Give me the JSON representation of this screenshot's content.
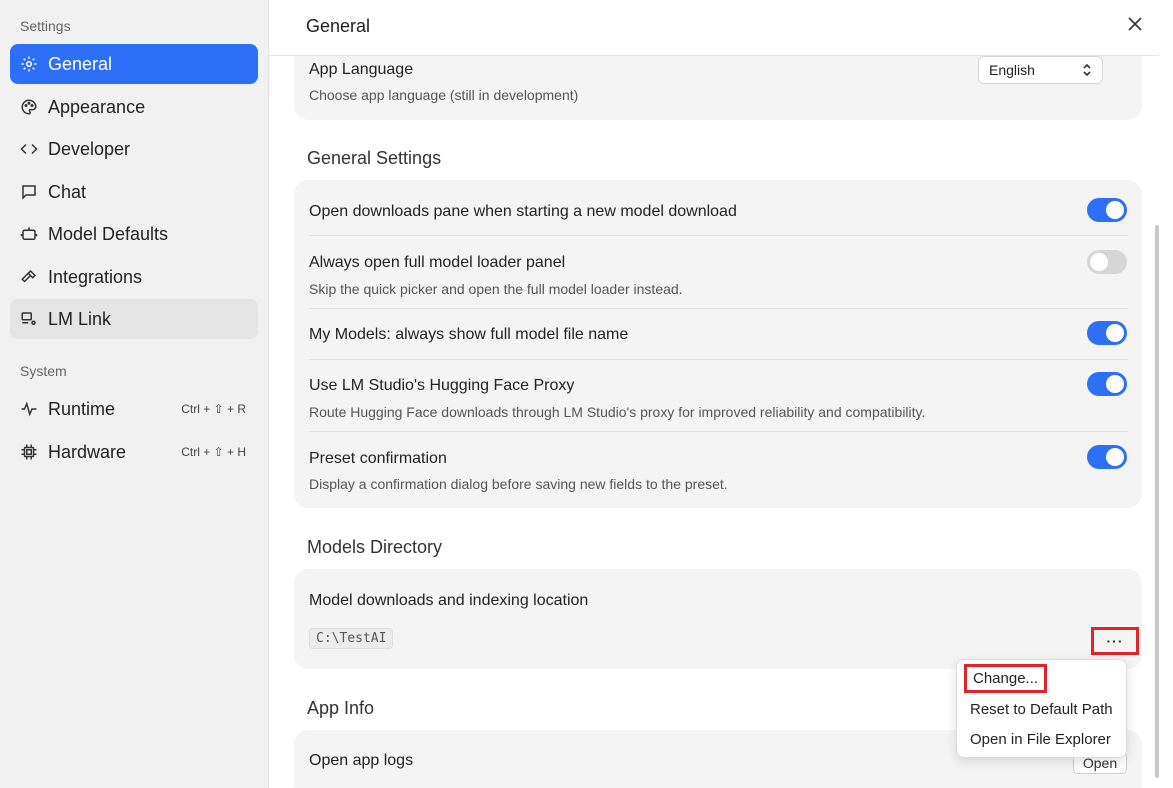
{
  "sidebar": {
    "settings_heading": "Settings",
    "system_heading": "System",
    "items": [
      {
        "label": "General"
      },
      {
        "label": "Appearance"
      },
      {
        "label": "Developer"
      },
      {
        "label": "Chat"
      },
      {
        "label": "Model Defaults"
      },
      {
        "label": "Integrations"
      },
      {
        "label": "LM Link"
      }
    ],
    "system_items": [
      {
        "label": "Runtime",
        "shortcut": "Ctrl + ⇧ + R"
      },
      {
        "label": "Hardware",
        "shortcut": "Ctrl + ⇧ + H"
      }
    ]
  },
  "header": {
    "title": "General"
  },
  "language": {
    "label": "App Language",
    "description": "Choose app language (still in development)",
    "selected": "English"
  },
  "general_settings": {
    "title": "General Settings",
    "rows": [
      {
        "label": "Open downloads pane when starting a new model download",
        "enabled": true
      },
      {
        "label": "Always open full model loader panel",
        "description": "Skip the quick picker and open the full model loader instead.",
        "enabled": false
      },
      {
        "label": "My Models: always show full model file name",
        "enabled": true
      },
      {
        "label": "Use LM Studio's Hugging Face Proxy",
        "description": "Route Hugging Face downloads through LM Studio's proxy for improved reliability and compatibility.",
        "enabled": true
      },
      {
        "label": "Preset confirmation",
        "description": "Display a confirmation dialog before saving new fields to the preset.",
        "enabled": true
      }
    ]
  },
  "models_directory": {
    "title": "Models Directory",
    "label": "Model downloads and indexing location",
    "path": "C:\\TestAI",
    "more_label": "···"
  },
  "context_menu": {
    "items": [
      "Change...",
      "Reset to Default Path",
      "Open in File Explorer"
    ]
  },
  "app_info": {
    "title": "App Info",
    "logs_label": "Open app logs",
    "open_button": "Open"
  },
  "colors": {
    "accent": "#2d6ff7",
    "highlight_box": "#e3222a"
  }
}
